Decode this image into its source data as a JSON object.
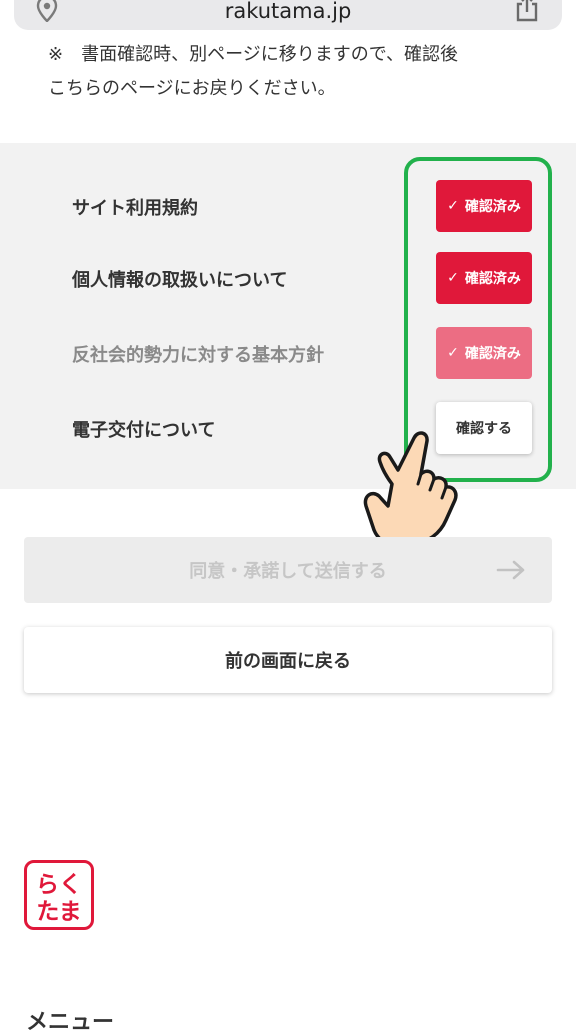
{
  "browser": {
    "url": "rakutama.jp"
  },
  "note": {
    "line1": "※　書面確認時、別ページに移りますので、確認後",
    "line2": "こちらのページにお戻りください。"
  },
  "documents": [
    {
      "label": "サイト利用規約",
      "status": "確認済み",
      "state": "confirmed"
    },
    {
      "label": "個人情報の取扱いについて",
      "status": "確認済み",
      "state": "confirmed"
    },
    {
      "label": "反社会的勢力に対する基本方針",
      "status": "確認済み",
      "state": "confirmed"
    },
    {
      "label": "電子交付について",
      "status": "確認する",
      "state": "unconfirmed"
    }
  ],
  "actions": {
    "submit_label": "同意・承諾して送信する",
    "back_label": "前の画面に戻る"
  },
  "logo": {
    "line1": "らく",
    "line2": "たま"
  },
  "menu": {
    "heading": "メニュー"
  },
  "colors": {
    "accent": "#e0183a",
    "highlight": "#22b14c"
  },
  "icons": [
    "location-pin-icon",
    "share-icon",
    "check-icon",
    "arrow-right-icon",
    "pointing-hand-icon"
  ]
}
